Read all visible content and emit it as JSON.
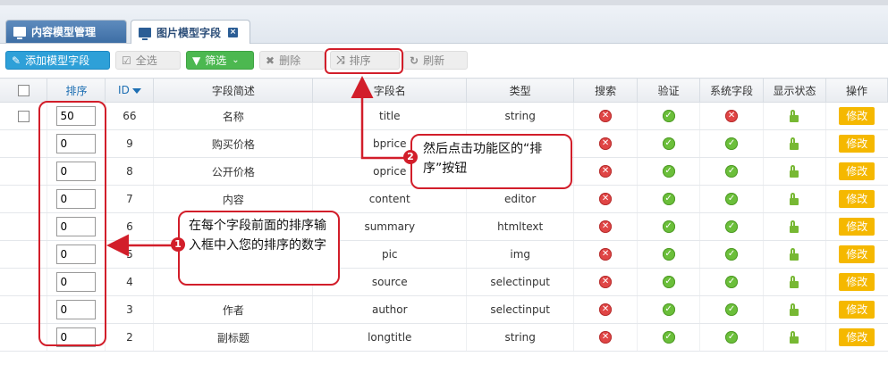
{
  "tabs": [
    {
      "label": "内容模型管理",
      "active": false
    },
    {
      "label": "图片模型字段",
      "active": true,
      "close": "×"
    }
  ],
  "toolbar": {
    "add": "添加模型字段",
    "select_all": "全选",
    "filter": "筛选",
    "delete": "删除",
    "sort": "排序",
    "refresh": "刷新"
  },
  "columns": {
    "sort": "排序",
    "id": "ID",
    "desc": "字段简述",
    "name": "字段名",
    "type": "类型",
    "search": "搜索",
    "validate": "验证",
    "system": "系统字段",
    "status": "显示状态",
    "action": "操作"
  },
  "rows": [
    {
      "sort": "50",
      "id": "66",
      "desc": "名称",
      "name": "title",
      "type": "string",
      "search": "no",
      "validate": "yes",
      "system": "no",
      "edit": "修改"
    },
    {
      "sort": "0",
      "id": "9",
      "desc": "购买价格",
      "name": "bprice",
      "type": "",
      "search": "no",
      "validate": "yes",
      "system": "yes",
      "edit": "修改"
    },
    {
      "sort": "0",
      "id": "8",
      "desc": "公开价格",
      "name": "oprice",
      "type": "",
      "search": "no",
      "validate": "yes",
      "system": "yes",
      "edit": "修改"
    },
    {
      "sort": "0",
      "id": "7",
      "desc": "内容",
      "name": "content",
      "type": "editor",
      "search": "no",
      "validate": "yes",
      "system": "yes",
      "edit": "修改"
    },
    {
      "sort": "0",
      "id": "6",
      "desc": "",
      "name": "summary",
      "type": "htmltext",
      "search": "no",
      "validate": "yes",
      "system": "yes",
      "edit": "修改"
    },
    {
      "sort": "0",
      "id": "5",
      "desc": "",
      "name": "pic",
      "type": "img",
      "search": "no",
      "validate": "yes",
      "system": "yes",
      "edit": "修改"
    },
    {
      "sort": "0",
      "id": "4",
      "desc": "",
      "name": "source",
      "type": "selectinput",
      "search": "no",
      "validate": "yes",
      "system": "yes",
      "edit": "修改"
    },
    {
      "sort": "0",
      "id": "3",
      "desc": "作者",
      "name": "author",
      "type": "selectinput",
      "search": "no",
      "validate": "yes",
      "system": "yes",
      "edit": "修改"
    },
    {
      "sort": "0",
      "id": "2",
      "desc": "副标题",
      "name": "longtitle",
      "type": "string",
      "search": "no",
      "validate": "yes",
      "system": "yes",
      "edit": "修改"
    }
  ],
  "annotations": {
    "step1_num": "1",
    "step1_text": "在每个字段前面的排序输入框中入您的排序的数字",
    "step2_num": "2",
    "step2_text": "然后点击功能区的“排序”按钮"
  },
  "colors": {
    "accent": "#2ea0d8",
    "callout": "#d21e2a",
    "edit": "#f5b800",
    "filter": "#4cb850"
  }
}
